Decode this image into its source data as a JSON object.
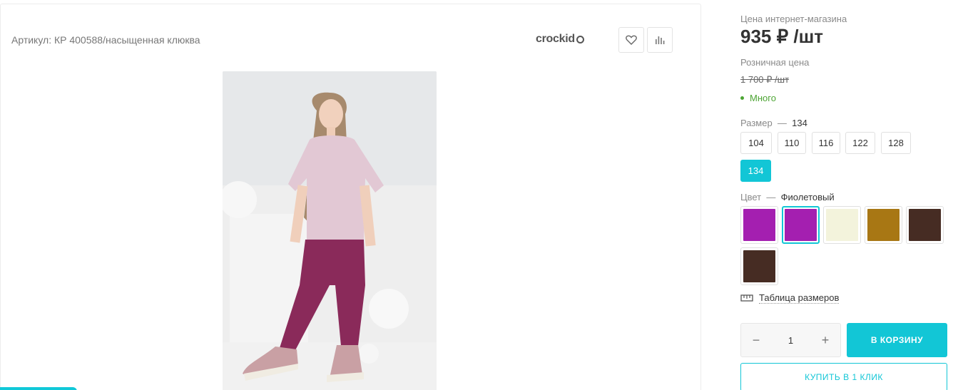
{
  "product": {
    "article": "Артикул: КР 400588/насыщенная клюква",
    "brand": "crockid",
    "image_alt": "Девочка в розовой футболке и фиолетовых брюках"
  },
  "pricing": {
    "online_label": "Цена интернет-магазина",
    "online_price": "935 ₽ /шт",
    "retail_label": "Розничная цена",
    "retail_price": "1 700 ₽ /шт",
    "stock": "Много",
    "stock_color": "#4da534"
  },
  "size": {
    "label": "Размер",
    "dash": "—",
    "selected": "134",
    "options": [
      "104",
      "110",
      "116",
      "122",
      "128",
      "134"
    ]
  },
  "color": {
    "label": "Цвет",
    "dash": "—",
    "selected": "Фиолетовый",
    "swatches": [
      "#a41fb0",
      "#a41fb0",
      "#f3f3dc",
      "#a87714",
      "#462c23",
      "#462c23"
    ],
    "selected_index": 1
  },
  "size_table": {
    "label": "Таблица размеров",
    "icon": "ruler-icon"
  },
  "cart": {
    "quantity": "1",
    "minus": "−",
    "plus": "+",
    "add_label": "В КОРЗИНУ",
    "one_click_label": "КУПИТЬ В 1 КЛИК"
  },
  "accent_color": "#12c6d6"
}
